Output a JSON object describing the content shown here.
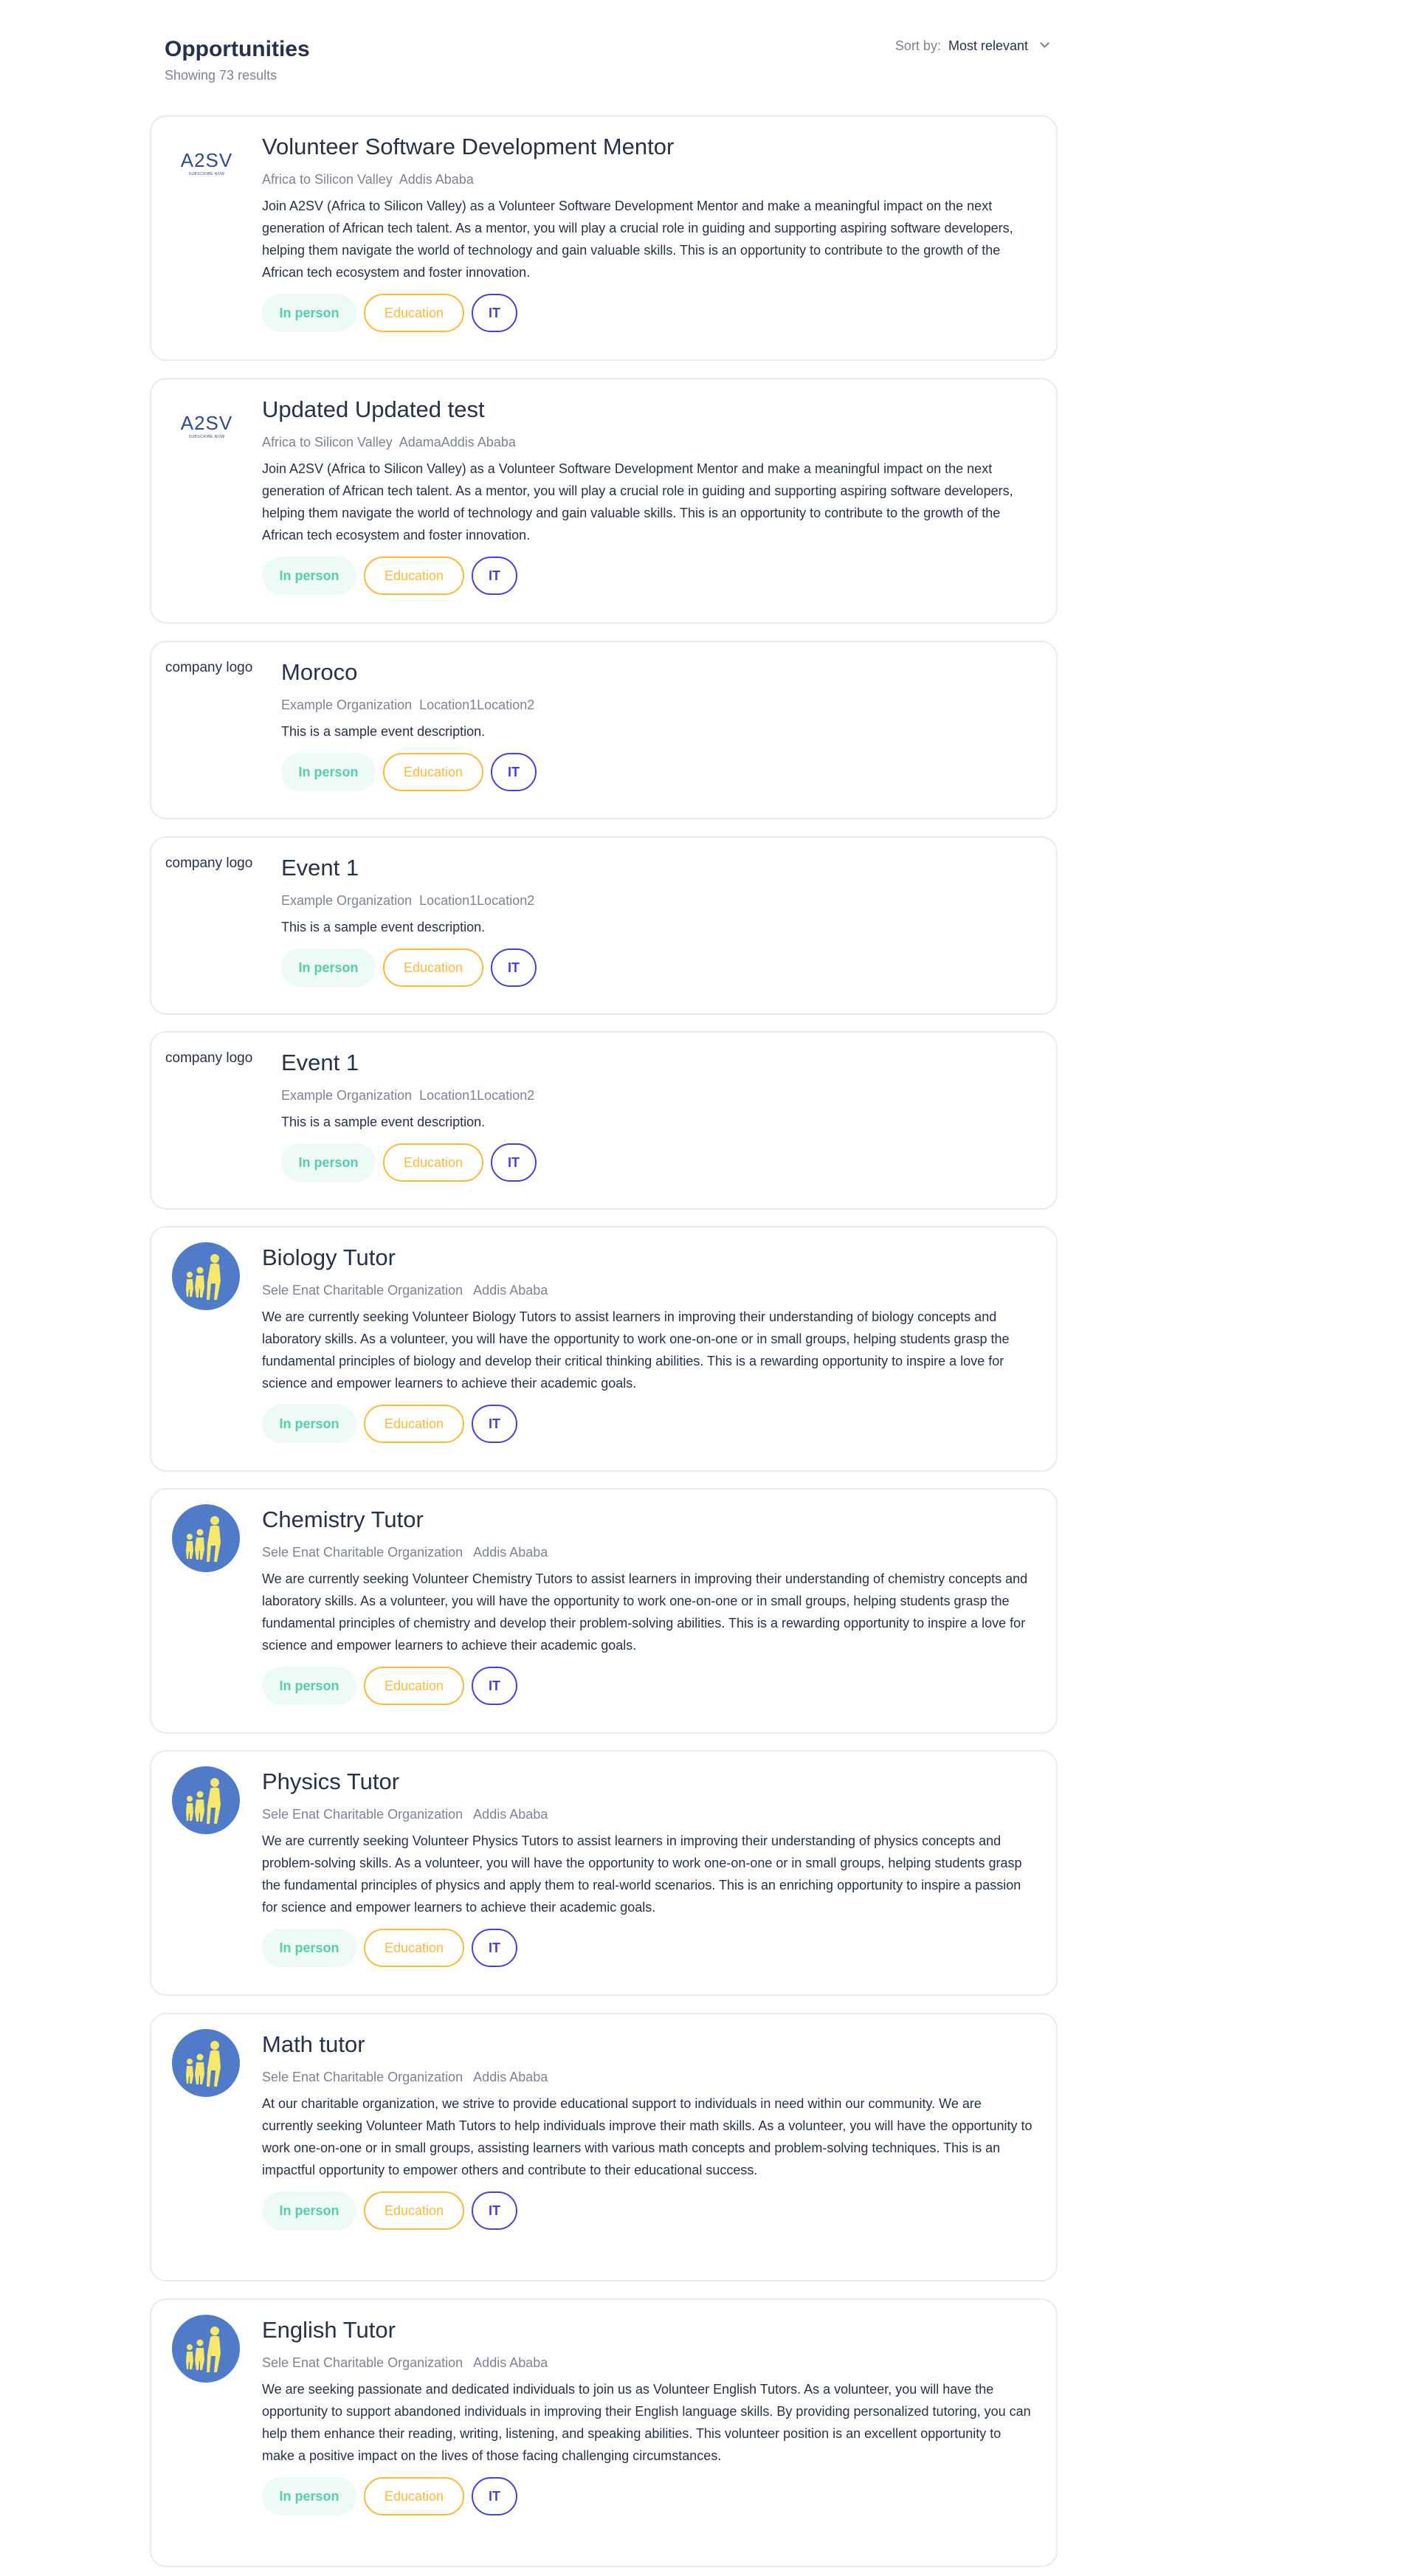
{
  "header": {
    "title": "Opportunities",
    "subtitle": "Showing 73 results",
    "sort_label": "Sort by:",
    "sort_value": "Most relevant"
  },
  "colors": {
    "in_person": "#56CDAD",
    "education": "#FFB836",
    "it": "#4640DE",
    "logo_circle": "#4F7BC8"
  },
  "cards": [
    {
      "title": "Volunteer Software Development Mentor",
      "meta": "Africa to Silicon Valley  Addis Ababa",
      "logo": "A2SV",
      "logo_sub": "SUBSCRIBE NOW",
      "description": "Join A2SV (Africa to Silicon Valley) as a Volunteer Software Development Mentor and make a meaningful impact on the next generation of African tech talent. As a mentor, you will play a crucial role in guiding and supporting aspiring software developers, helping them navigate the world of technology and gain valuable skills. This is an opportunity to contribute to the growth of the African tech ecosystem and foster innovation.",
      "tags": [
        "In person",
        "Education",
        "IT"
      ]
    },
    {
      "title": "Updated Updated test",
      "meta": "Africa to Silicon Valley  AdamaAddis Ababa",
      "logo": "A2SV",
      "logo_sub": "SUBSCRIBE NOW",
      "description": "Join A2SV (Africa to Silicon Valley) as a Volunteer Software Development Mentor and make a meaningful impact on the next generation of African tech talent. As a mentor, you will play a crucial role in guiding and supporting aspiring software developers, helping them navigate the world of technology and gain valuable skills. This is an opportunity to contribute to the growth of the African tech ecosystem and foster innovation.",
      "tags": [
        "In person",
        "Education",
        "IT"
      ]
    },
    {
      "title": "Moroco",
      "meta": "Example Organization  Location1Location2",
      "logo_alt": "company logo",
      "description": "This is a sample event description.",
      "tags": [
        "In person",
        "Education",
        "IT"
      ]
    },
    {
      "title": "Event 1",
      "meta": "Example Organization  Location1Location2",
      "logo_alt": "company logo",
      "description": "This is a sample event description.",
      "tags": [
        "In person",
        "Education",
        "IT"
      ]
    },
    {
      "title": "Event 1",
      "meta": "Example Organization  Location1Location2",
      "logo_alt": "company logo",
      "description": "This is a sample event description.",
      "tags": [
        "In person",
        "Education",
        "IT"
      ]
    },
    {
      "title": "Biology Tutor",
      "meta": "Sele Enat Charitable Organization   Addis Ababa",
      "description": "We are currently seeking Volunteer Biology Tutors to assist learners in improving their understanding of biology concepts and laboratory skills. As a volunteer, you will have the opportunity to work one-on-one or in small groups, helping students grasp the fundamental principles of biology and develop their critical thinking abilities. This is a rewarding opportunity to inspire a love for science and empower learners to achieve their academic goals.",
      "tags": [
        "In person",
        "Education",
        "IT"
      ]
    },
    {
      "title": "Chemistry Tutor",
      "meta": "Sele Enat Charitable Organization   Addis Ababa",
      "description": "We are currently seeking Volunteer Chemistry Tutors to assist learners in improving their understanding of chemistry concepts and laboratory skills. As a volunteer, you will have the opportunity to work one-on-one or in small groups, helping students grasp the fundamental principles of chemistry and develop their problem-solving abilities. This is a rewarding opportunity to inspire a love for science and empower learners to achieve their academic goals.",
      "tags": [
        "In person",
        "Education",
        "IT"
      ]
    },
    {
      "title": "Physics Tutor",
      "meta": "Sele Enat Charitable Organization   Addis Ababa",
      "description": "We are currently seeking Volunteer Physics Tutors to assist learners in improving their understanding of physics concepts and problem-solving skills. As a volunteer, you will have the opportunity to work one-on-one or in small groups, helping students grasp the fundamental principles of physics and apply them to real-world scenarios. This is an enriching opportunity to inspire a passion for science and empower learners to achieve their academic goals.",
      "tags": [
        "In person",
        "Education",
        "IT"
      ]
    },
    {
      "title": "Math tutor",
      "meta": "Sele Enat Charitable Organization   Addis Ababa",
      "description": "At our charitable organization, we strive to provide educational support to individuals in need within our community. We are currently seeking Volunteer Math Tutors to help individuals improve their math skills. As a volunteer, you will have the opportunity to work one-on-one or in small groups, assisting learners with various math concepts and problem-solving techniques. This is an impactful opportunity to empower others and contribute to their educational success.",
      "tags": [
        "In person",
        "Education",
        "IT"
      ]
    },
    {
      "title": "English Tutor",
      "meta": "Sele Enat Charitable Organization   Addis Ababa",
      "description": "We are seeking passionate and dedicated individuals to join us as Volunteer English Tutors. As a volunteer, you will have the opportunity to support abandoned individuals in improving their English language skills. By providing personalized tutoring, you can help them enhance their reading, writing, listening, and speaking abilities. This volunteer position is an excellent opportunity to make a positive impact on the lives of those facing challenging circumstances.",
      "tags": [
        "In person",
        "Education",
        "IT"
      ]
    }
  ]
}
